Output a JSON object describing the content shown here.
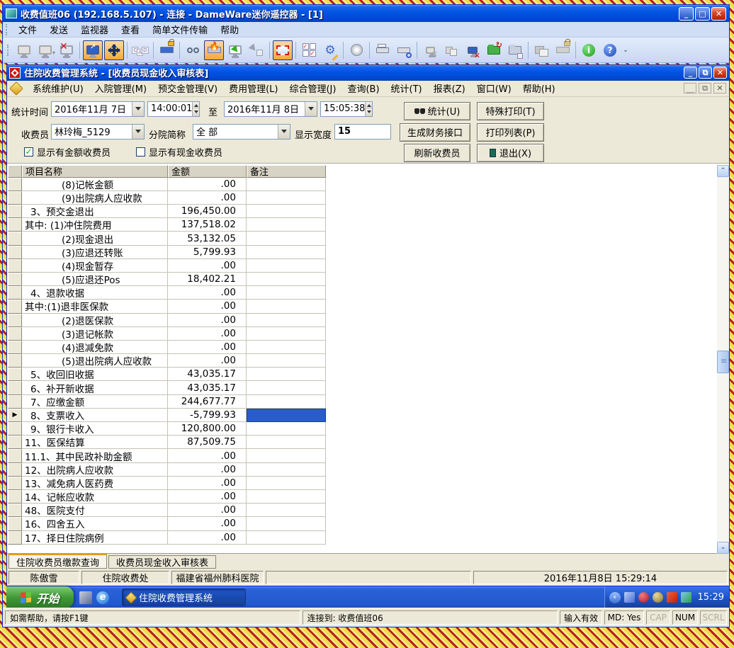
{
  "dameware": {
    "title": "收费值班06 (192.168.5.107) - 连接 - DameWare迷你遥控器 - [1]",
    "menu": [
      "文件",
      "发送",
      "监视器",
      "查看",
      "简单文件传输",
      "帮助"
    ],
    "toolbar_icons": [
      "connect-icon",
      "reconnect-icon",
      "disconnect-icon",
      "fullscreen-icon",
      "pan-arrows-icon",
      "ctrl-alt-del-icon",
      "lock-keyboard-icon",
      "view-only-icon",
      "flame-keyboard-icon",
      "remote-cursor-icon",
      "local-cursor-icon",
      "screen-border-icon",
      "settings-checks-icon",
      "tools-gear-icon",
      "cd-icon",
      "print-icon",
      "print-preview-icon",
      "net-disconnect-icon",
      "net-window-icon",
      "monitor-delete-icon",
      "folder-transfer-icon",
      "folder-app-icon",
      "layered-windows-icon",
      "keyboard-unlock-icon",
      "info-icon",
      "help-icon"
    ],
    "status": {
      "help": "如需帮助，请按F1键",
      "connection": "连接到: 收费值班06",
      "input": "输入有效",
      "md": "MD: Yes",
      "cap": "CAP",
      "num": "NUM",
      "scrl": "SCRL"
    }
  },
  "app": {
    "title": "住院收费管理系统 - [收费员现金收入审核表]",
    "menu": [
      "系统维护(U)",
      "入院管理(M)",
      "预交金管理(V)",
      "费用管理(L)",
      "综合管理(J)",
      "查询(B)",
      "统计(T)",
      "报表(Z)",
      "窗口(W)",
      "帮助(H)"
    ],
    "form": {
      "stat_time_label": "统计时间",
      "date_from": "2016年11月 7日",
      "time_from": "14:00:01",
      "to_label": "至",
      "date_to": "2016年11月 8日",
      "time_to": "15:05:38",
      "cashier_label": "收费员",
      "cashier_value": "林玲梅_5129",
      "branch_label": "分院简称",
      "branch_value": "全 部",
      "width_label": "显示宽度",
      "width_value": "15",
      "chk_amount_label": "显示有金额收费员",
      "chk_amount_checked": "✓",
      "chk_cash_label": "显示有现金收费员"
    },
    "buttons": {
      "stat": "统计(U)",
      "special_print": "特殊打印(T)",
      "fin_interface": "生成财务接口",
      "print_list": "打印列表(P)",
      "refresh": "刷新收费员",
      "exit": "退出(X)"
    },
    "table": {
      "headers": [
        "项目名称",
        "金额",
        "备注"
      ],
      "rows": [
        {
          "name": "(8)记帐金额",
          "amount": ".00",
          "remark": "",
          "indent": 2
        },
        {
          "name": "(9)出院病人应收款",
          "amount": ".00",
          "remark": "",
          "indent": 2
        },
        {
          "name": "3、预交金退出",
          "amount": "196,450.00",
          "remark": "",
          "indent": 1
        },
        {
          "name": "其中: (1)冲住院费用",
          "amount": "137,518.02",
          "remark": "",
          "indent": 0
        },
        {
          "name": "(2)现金退出",
          "amount": "53,132.05",
          "remark": "",
          "indent": 2
        },
        {
          "name": "(3)应退还转账",
          "amount": "5,799.93",
          "remark": "",
          "indent": 2
        },
        {
          "name": "(4)现金暂存",
          "amount": ".00",
          "remark": "",
          "indent": 2
        },
        {
          "name": "(5)应退还Pos",
          "amount": "18,402.21",
          "remark": "",
          "indent": 2
        },
        {
          "name": "4、退款收据",
          "amount": ".00",
          "remark": "",
          "indent": 1
        },
        {
          "name": "其中:(1)退非医保款",
          "amount": ".00",
          "remark": "",
          "indent": 0
        },
        {
          "name": "(2)退医保款",
          "amount": ".00",
          "remark": "",
          "indent": 2
        },
        {
          "name": "(3)退记帐款",
          "amount": ".00",
          "remark": "",
          "indent": 2
        },
        {
          "name": "(4)退减免款",
          "amount": ".00",
          "remark": "",
          "indent": 2
        },
        {
          "name": "(5)退出院病人应收款",
          "amount": ".00",
          "remark": "",
          "indent": 2
        },
        {
          "name": "5、收回旧收据",
          "amount": "43,035.17",
          "remark": "",
          "indent": 1
        },
        {
          "name": "6、补开新收据",
          "amount": "43,035.17",
          "remark": "",
          "indent": 1
        },
        {
          "name": "7、应缴金额",
          "amount": "244,677.77",
          "remark": "",
          "indent": 1
        },
        {
          "name": "8、支票收入",
          "amount": "-5,799.93",
          "remark": "",
          "indent": 1,
          "pointer": true,
          "selected": true
        },
        {
          "name": "9、银行卡收入",
          "amount": "120,800.00",
          "remark": "",
          "indent": 1
        },
        {
          "name": "11、医保结算",
          "amount": "87,509.75",
          "remark": "",
          "indent": 0
        },
        {
          "name": "11.1、其中民政补助金额",
          "amount": ".00",
          "remark": "",
          "indent": 0
        },
        {
          "name": "12、出院病人应收款",
          "amount": ".00",
          "remark": "",
          "indent": 0
        },
        {
          "name": "13、减免病人医药费",
          "amount": ".00",
          "remark": "",
          "indent": 0
        },
        {
          "name": "14、记帐应收款",
          "amount": ".00",
          "remark": "",
          "indent": 0
        },
        {
          "name": "48、医院支付",
          "amount": ".00",
          "remark": "",
          "indent": 0
        },
        {
          "name": "16、四舍五入",
          "amount": ".00",
          "remark": "",
          "indent": 0
        },
        {
          "name": "17、择日住院病例",
          "amount": ".00",
          "remark": "",
          "indent": 0
        }
      ],
      "pointer_glyph": "▶"
    },
    "tabs": [
      "住院收费员缴款查询",
      "收费员现金收入审核表"
    ],
    "statusbar": {
      "user": "陈傲雪",
      "dept": "住院收费处",
      "hospital": "福建省福州肺科医院",
      "datetime": "2016年11月8日  15:29:14"
    }
  },
  "taskbar": {
    "start_label": "开始",
    "task_label": "住院收费管理系统",
    "clock": "15:29",
    "tray_icons": [
      "collapse-chevron-icon",
      "network-icon",
      "security-icon",
      "audio-icon",
      "monitors-icon",
      "sync-icon"
    ],
    "quick_launch_icons": [
      "app-launcher-icon",
      "internet-explorer-icon"
    ]
  },
  "colors": {
    "titlebar_blue": "#0054e3",
    "selection_blue": "#2a5cc8",
    "form_beige": "#ece9d8",
    "toolbar_active_orange": "#f5a93e",
    "taskbar_green": "#3f9a37"
  }
}
